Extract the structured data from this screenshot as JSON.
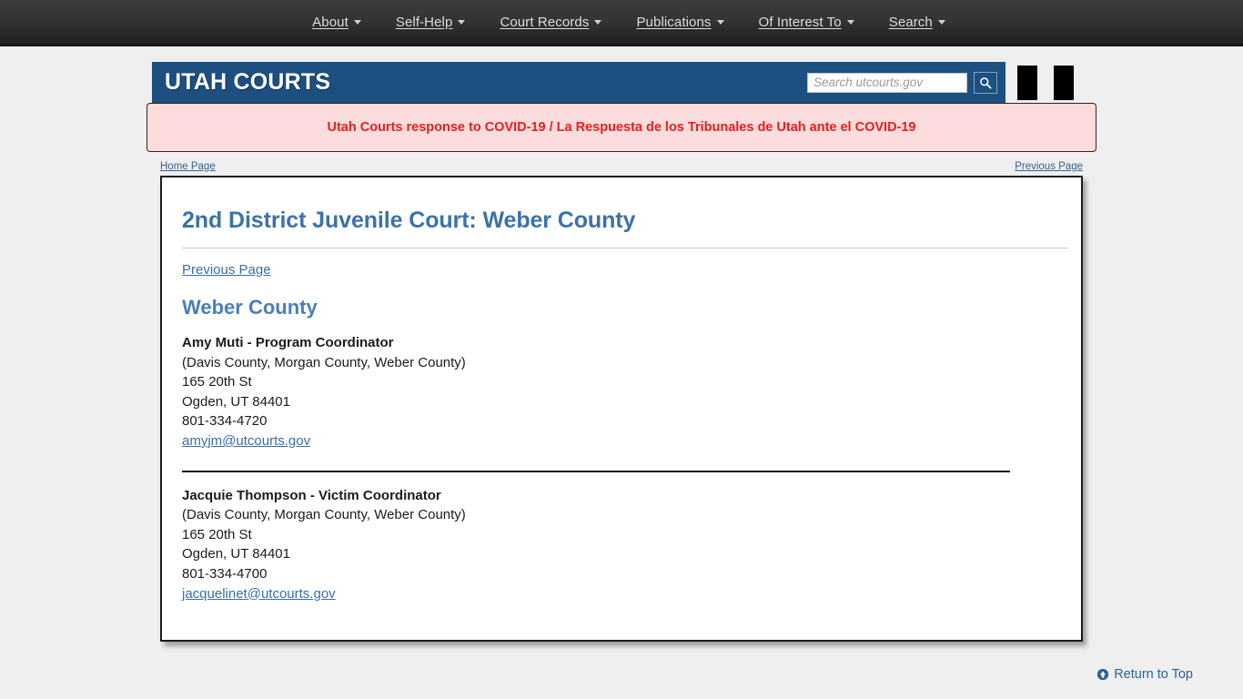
{
  "topnav": {
    "items": [
      {
        "label": "About",
        "has_caret": true
      },
      {
        "label": "Self-Help",
        "has_caret": true
      },
      {
        "label": "Court Records",
        "has_caret": true
      },
      {
        "label": "Publications",
        "has_caret": true
      },
      {
        "label": "Of Interest To",
        "has_caret": true
      },
      {
        "label": "Search",
        "has_caret": true
      }
    ]
  },
  "header": {
    "brand": "UTAH COURTS",
    "brand_bg": "#1d4f80",
    "search": {
      "value": "",
      "placeholder": "Search utcourts.gov",
      "button_icon": "search-icon"
    }
  },
  "alert": {
    "text": "Utah Courts response to COVID-19 / La Respuesta de los Tribunales de Utah ante el COVID-19",
    "text_color": "#ee1c1c",
    "background": "#fcdcdc"
  },
  "breadcrumb": {
    "home": "Home Page",
    "previous": "Previous Page"
  },
  "main": {
    "title": "2nd District Juvenile Court: Weber County",
    "previous_link": "Previous Page",
    "section_title": "Weber County",
    "contacts": [
      {
        "name": "Amy Muti - Program Coordinator",
        "counties": "(Davis County, Morgan County, Weber County)",
        "street": "165 20th St",
        "city_state_zip": "Ogden, UT 84401",
        "phone": "801-334-4720",
        "email": "amyjm@utcourts.gov"
      },
      {
        "name": "Jacquie Thompson - Victim Coordinator",
        "counties": "(Davis County, Morgan County, Weber County)",
        "street": "165 20th St",
        "city_state_zip": "Ogden, UT 84401",
        "phone": "801-334-4700",
        "email": "jacquelinet@utcourts.gov"
      }
    ]
  },
  "footer": {
    "return_to_top": "Return to Top",
    "return_icon": "circle-up-arrow-icon",
    "link_color": "#2f6094"
  }
}
